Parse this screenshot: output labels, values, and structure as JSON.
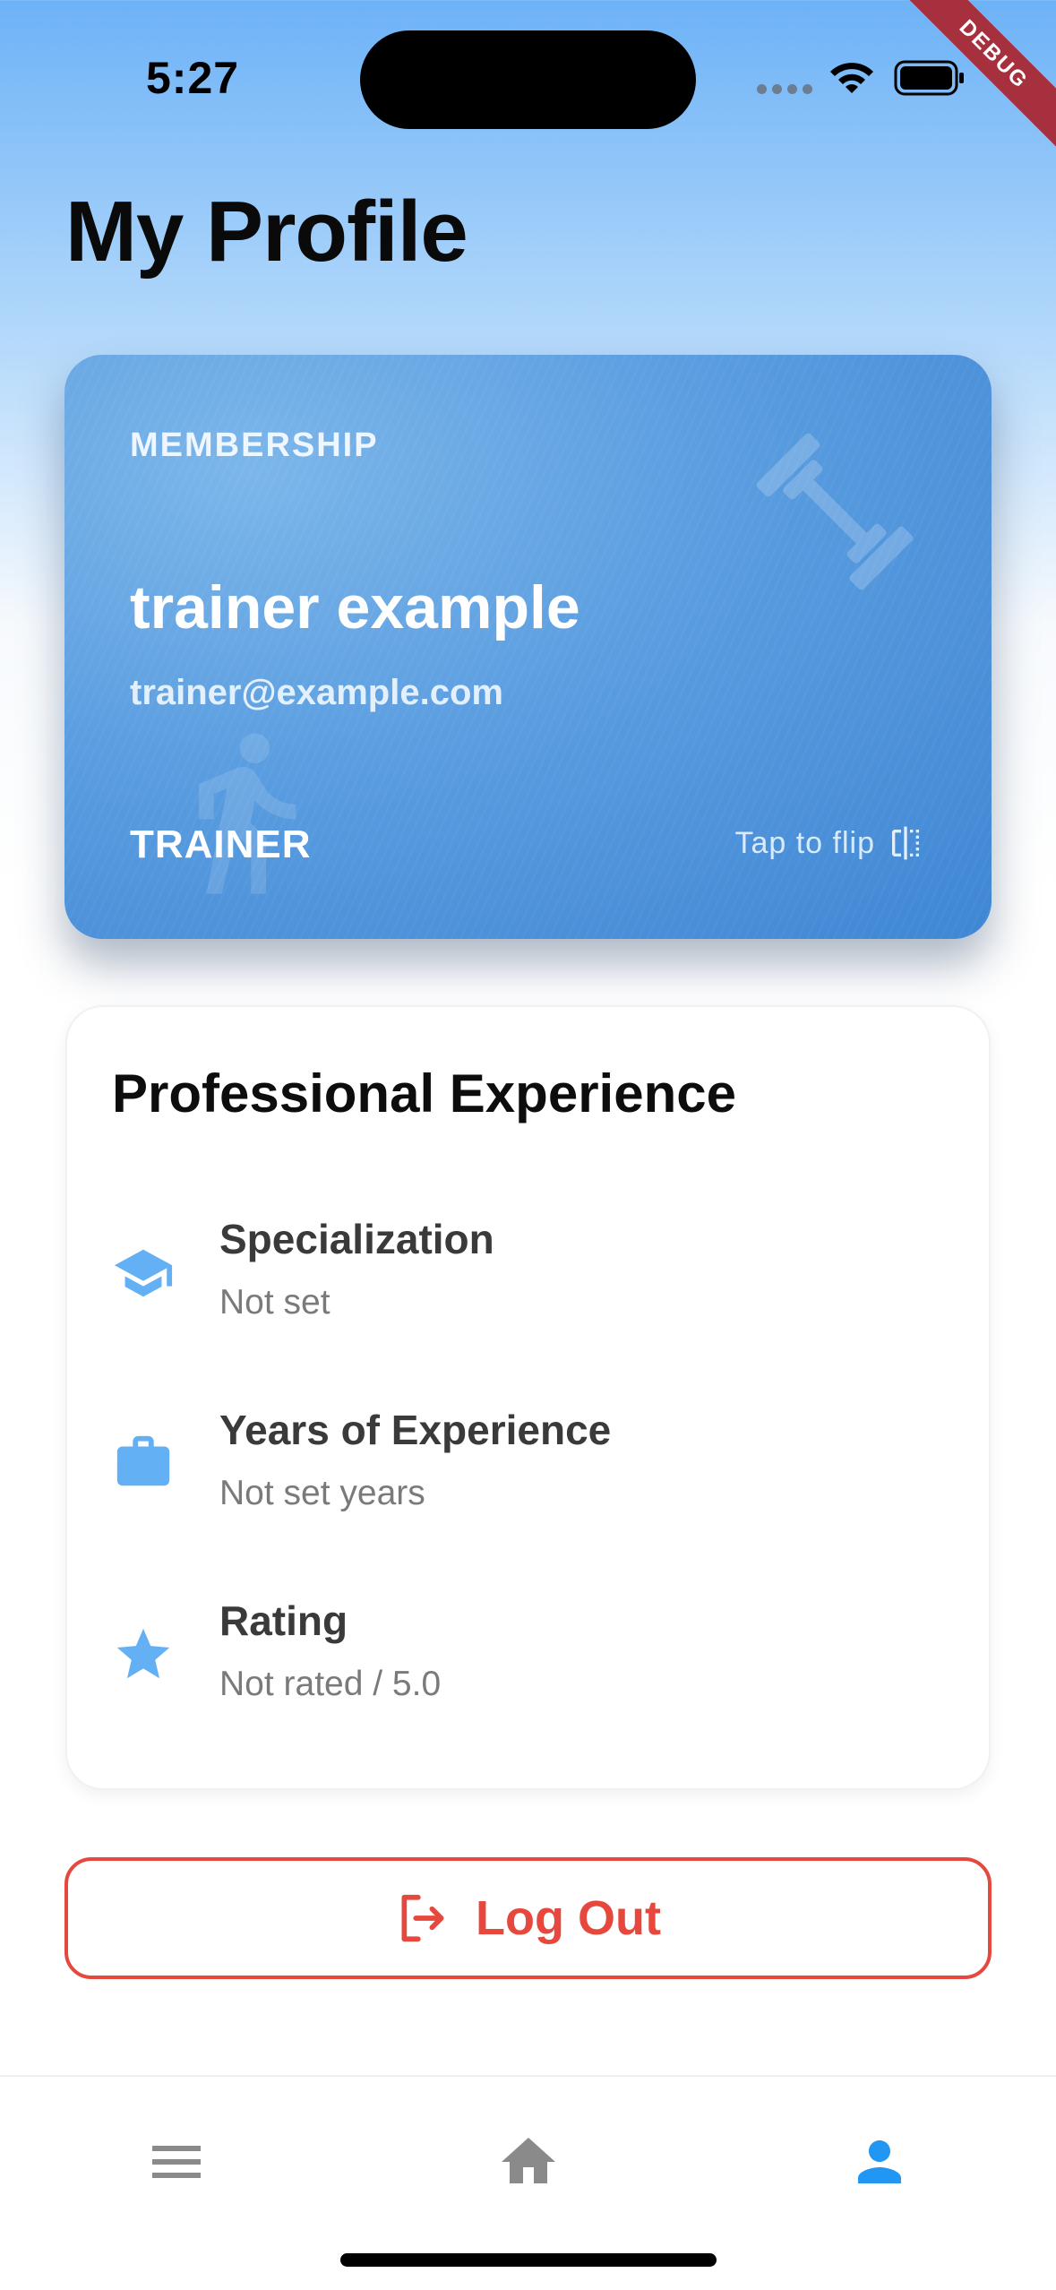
{
  "status_bar": {
    "time": "5:27",
    "debug_label": "DEBUG"
  },
  "page": {
    "title": "My Profile"
  },
  "membership_card": {
    "label": "MEMBERSHIP",
    "name": "trainer example",
    "email": "trainer@example.com",
    "role": "TRAINER",
    "flip_hint": "Tap to flip"
  },
  "experience": {
    "title": "Professional Experience",
    "items": [
      {
        "icon": "graduation-cap-icon",
        "label": "Specialization",
        "value": "Not set"
      },
      {
        "icon": "briefcase-icon",
        "label": "Years of Experience",
        "value": "Not set years"
      },
      {
        "icon": "star-icon",
        "label": "Rating",
        "value": "Not rated / 5.0"
      }
    ]
  },
  "logout": {
    "label": "Log Out",
    "color": "#e6483d"
  },
  "nav": {
    "items": [
      {
        "icon": "menu-icon",
        "active": false
      },
      {
        "icon": "home-icon",
        "active": false
      },
      {
        "icon": "person-icon",
        "active": true
      }
    ],
    "active_color": "#2196f3",
    "inactive_color": "#8a8a8a"
  },
  "colors": {
    "accent": "#2196f3",
    "icon_blue": "#64b0f4"
  }
}
